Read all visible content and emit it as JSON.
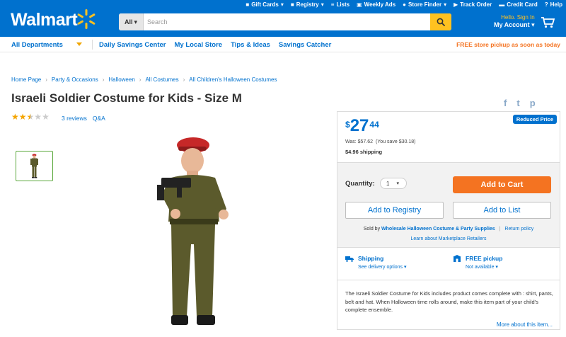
{
  "header": {
    "logo_text": "Walmart",
    "utility": [
      {
        "icon": "gift-card-icon",
        "label": "Gift Cards",
        "caret": true
      },
      {
        "icon": "registry-icon",
        "label": "Registry",
        "caret": true
      },
      {
        "icon": "list-icon",
        "label": "Lists",
        "caret": false
      },
      {
        "icon": "weekly-ads-icon",
        "label": "Weekly Ads",
        "caret": false
      },
      {
        "icon": "store-finder-icon",
        "label": "Store Finder",
        "caret": true
      },
      {
        "icon": "track-order-icon",
        "label": "Track Order",
        "caret": false
      },
      {
        "icon": "credit-card-icon",
        "label": "Credit Card",
        "caret": false
      },
      {
        "icon": "help-icon",
        "label": "Help",
        "caret": false
      }
    ],
    "search_dept": "All",
    "search_placeholder": "Search",
    "account_greeting": "Hello. Sign In",
    "account_label": "My Account"
  },
  "nav": {
    "departments": "All Departments",
    "links": [
      "Daily Savings Center",
      "My Local Store",
      "Tips & Ideas",
      "Savings Catcher"
    ],
    "promo": "FREE store pickup as soon as today"
  },
  "breadcrumbs": [
    "Home Page",
    "Party & Occasions",
    "Halloween",
    "All Costumes",
    "All Children's Halloween Costumes"
  ],
  "product": {
    "title": "Israeli Soldier Costume for Kids - Size M",
    "rating": 2.5,
    "reviews": "3 reviews",
    "qa": "Q&A"
  },
  "buybox": {
    "badge": "Reduced Price",
    "currency": "$",
    "dollars": "27",
    "cents": "44",
    "was": "Was: $57.62",
    "save": "(You save $30.18)",
    "shipping_cost": "$4.96 shipping",
    "quantity_label": "Quantity:",
    "quantity_value": "1",
    "add_to_cart": "Add to Cart",
    "add_to_registry": "Add to Registry",
    "add_to_list": "Add to List",
    "sold_by_prefix": "Sold by",
    "seller": "Wholesale Halloween Costume & Party Supplies",
    "return_policy": "Return policy",
    "learn_more": "Learn about Marketplace Retailers",
    "shipping_title": "Shipping",
    "shipping_sub": "See delivery options",
    "pickup_title": "FREE pickup",
    "pickup_sub": "Not available",
    "description": "The Israeli Soldier Costume for Kids includes product comes complete with : shirt, pants, belt and hat. When Halloween time rolls around, make this item part of your child's complete ensemble.",
    "more_link": "More about this item..."
  },
  "colors": {
    "brand_blue": "#0071ce",
    "spark_yellow": "#ffc220",
    "cta_orange": "#f47321",
    "star_gold": "#f4a500"
  }
}
